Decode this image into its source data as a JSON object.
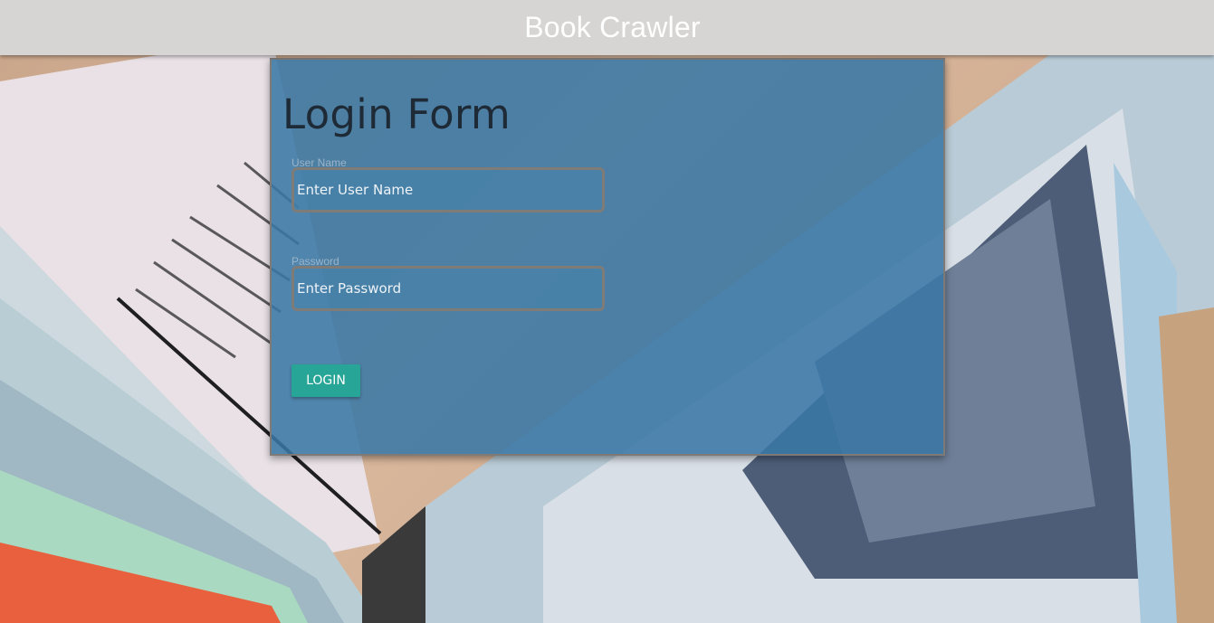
{
  "app": {
    "title": "Book Crawler"
  },
  "login_form": {
    "title": "Login Form",
    "username": {
      "label": "User Name",
      "placeholder": "Enter User Name",
      "value": ""
    },
    "password": {
      "label": "Password",
      "placeholder": "Enter Password",
      "value": ""
    },
    "submit_label": "LOGIN"
  },
  "colors": {
    "app_bar": "#d6d5d3",
    "panel": "#3a78a5",
    "button": "#27a596",
    "title_text": "#1e2a36"
  },
  "background": {
    "image_description_icon": "open-book-image"
  }
}
